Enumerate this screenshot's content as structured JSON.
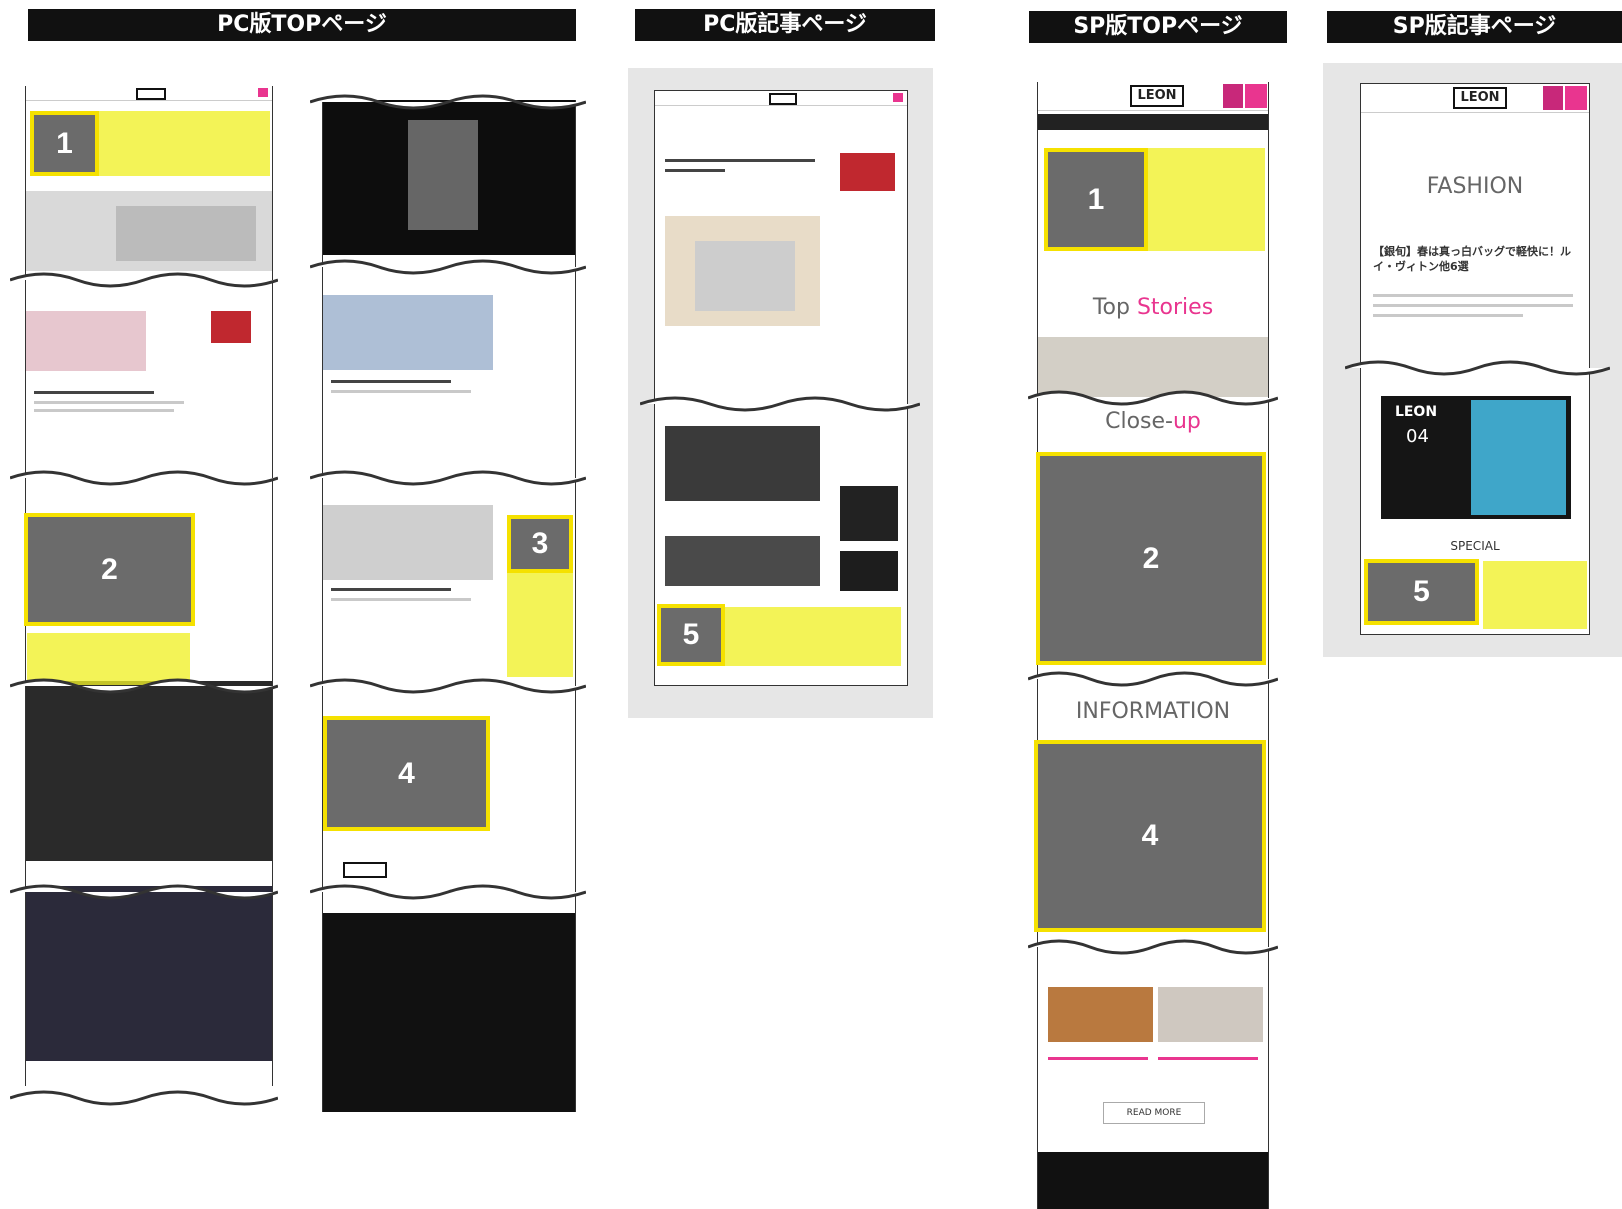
{
  "headers": {
    "pc_top": "PC版TOPページ",
    "pc_article": "PC版記事ページ",
    "sp_top": "SP版TOPページ",
    "sp_article": "SP版記事ページ"
  },
  "ad_slots": {
    "pc_top_1": "1",
    "pc_top_2": "2",
    "pc_top_3": "3",
    "pc_top_4": "4",
    "pc_article_5": "5",
    "sp_top_1": "1",
    "sp_top_2": "2",
    "sp_top_4": "4",
    "sp_article_5": "5"
  },
  "sp_top": {
    "logo": "LEON",
    "top_stories_a": "Top ",
    "top_stories_b": "Stories",
    "closeup_a": "Close-",
    "closeup_b": "up",
    "information": "INFORMATION",
    "read_more": "READ MORE"
  },
  "sp_article": {
    "logo": "LEON",
    "section": "FASHION",
    "headline": "【銀旬】春は真っ白バッグで軽快に！ルイ・ヴィトン他6選",
    "mag_logo": "LEON",
    "mag_issue": "04",
    "special": "SPECIAL"
  },
  "colors": {
    "highlight": "#f5e100",
    "ad_fill": "#6b6b6b",
    "brand_pink": "#e9358f",
    "header_bg": "#111111"
  }
}
